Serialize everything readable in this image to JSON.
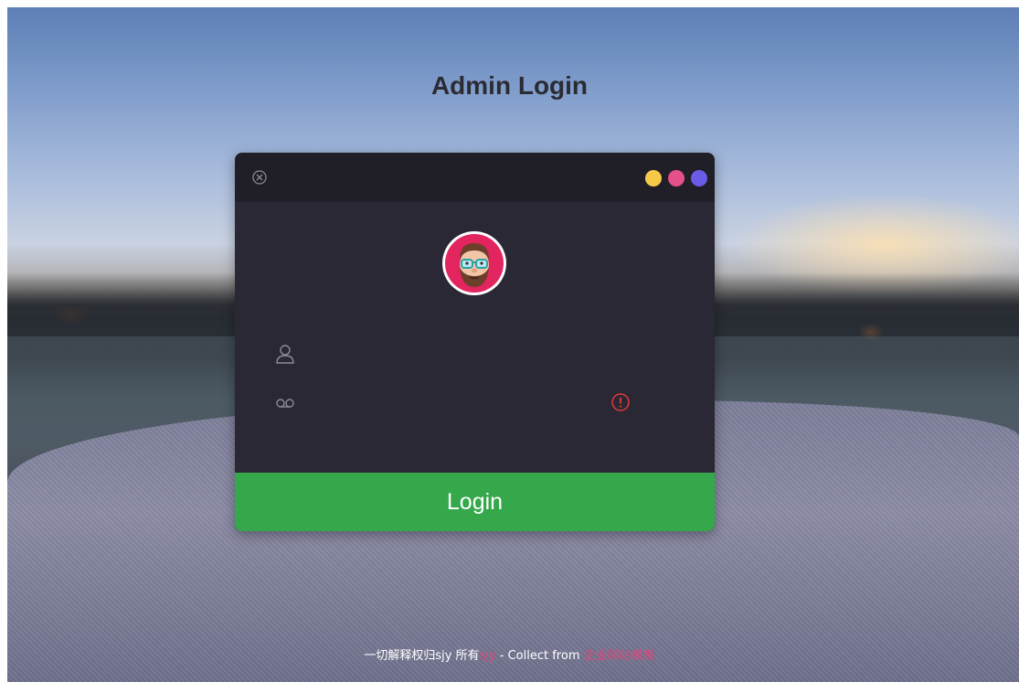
{
  "page": {
    "title": "Admin Login"
  },
  "card": {
    "window_dots": [
      "#f7c948",
      "#e5508a",
      "#6b5ce7"
    ],
    "username": {
      "value": "",
      "placeholder": ""
    },
    "password": {
      "value": "",
      "placeholder": ""
    },
    "login_label": "Login"
  },
  "footer": {
    "prefix": "一切解释权归sjy 所有",
    "author_link": "sjy",
    "middle": " - Collect from ",
    "source_link": "企业网站模板"
  },
  "colors": {
    "accent_green": "#35a84b",
    "link_pink": "#e0457b",
    "warning_red": "#e03b3b",
    "card_bg": "#2a2834",
    "titlebar_bg": "#201f27"
  }
}
